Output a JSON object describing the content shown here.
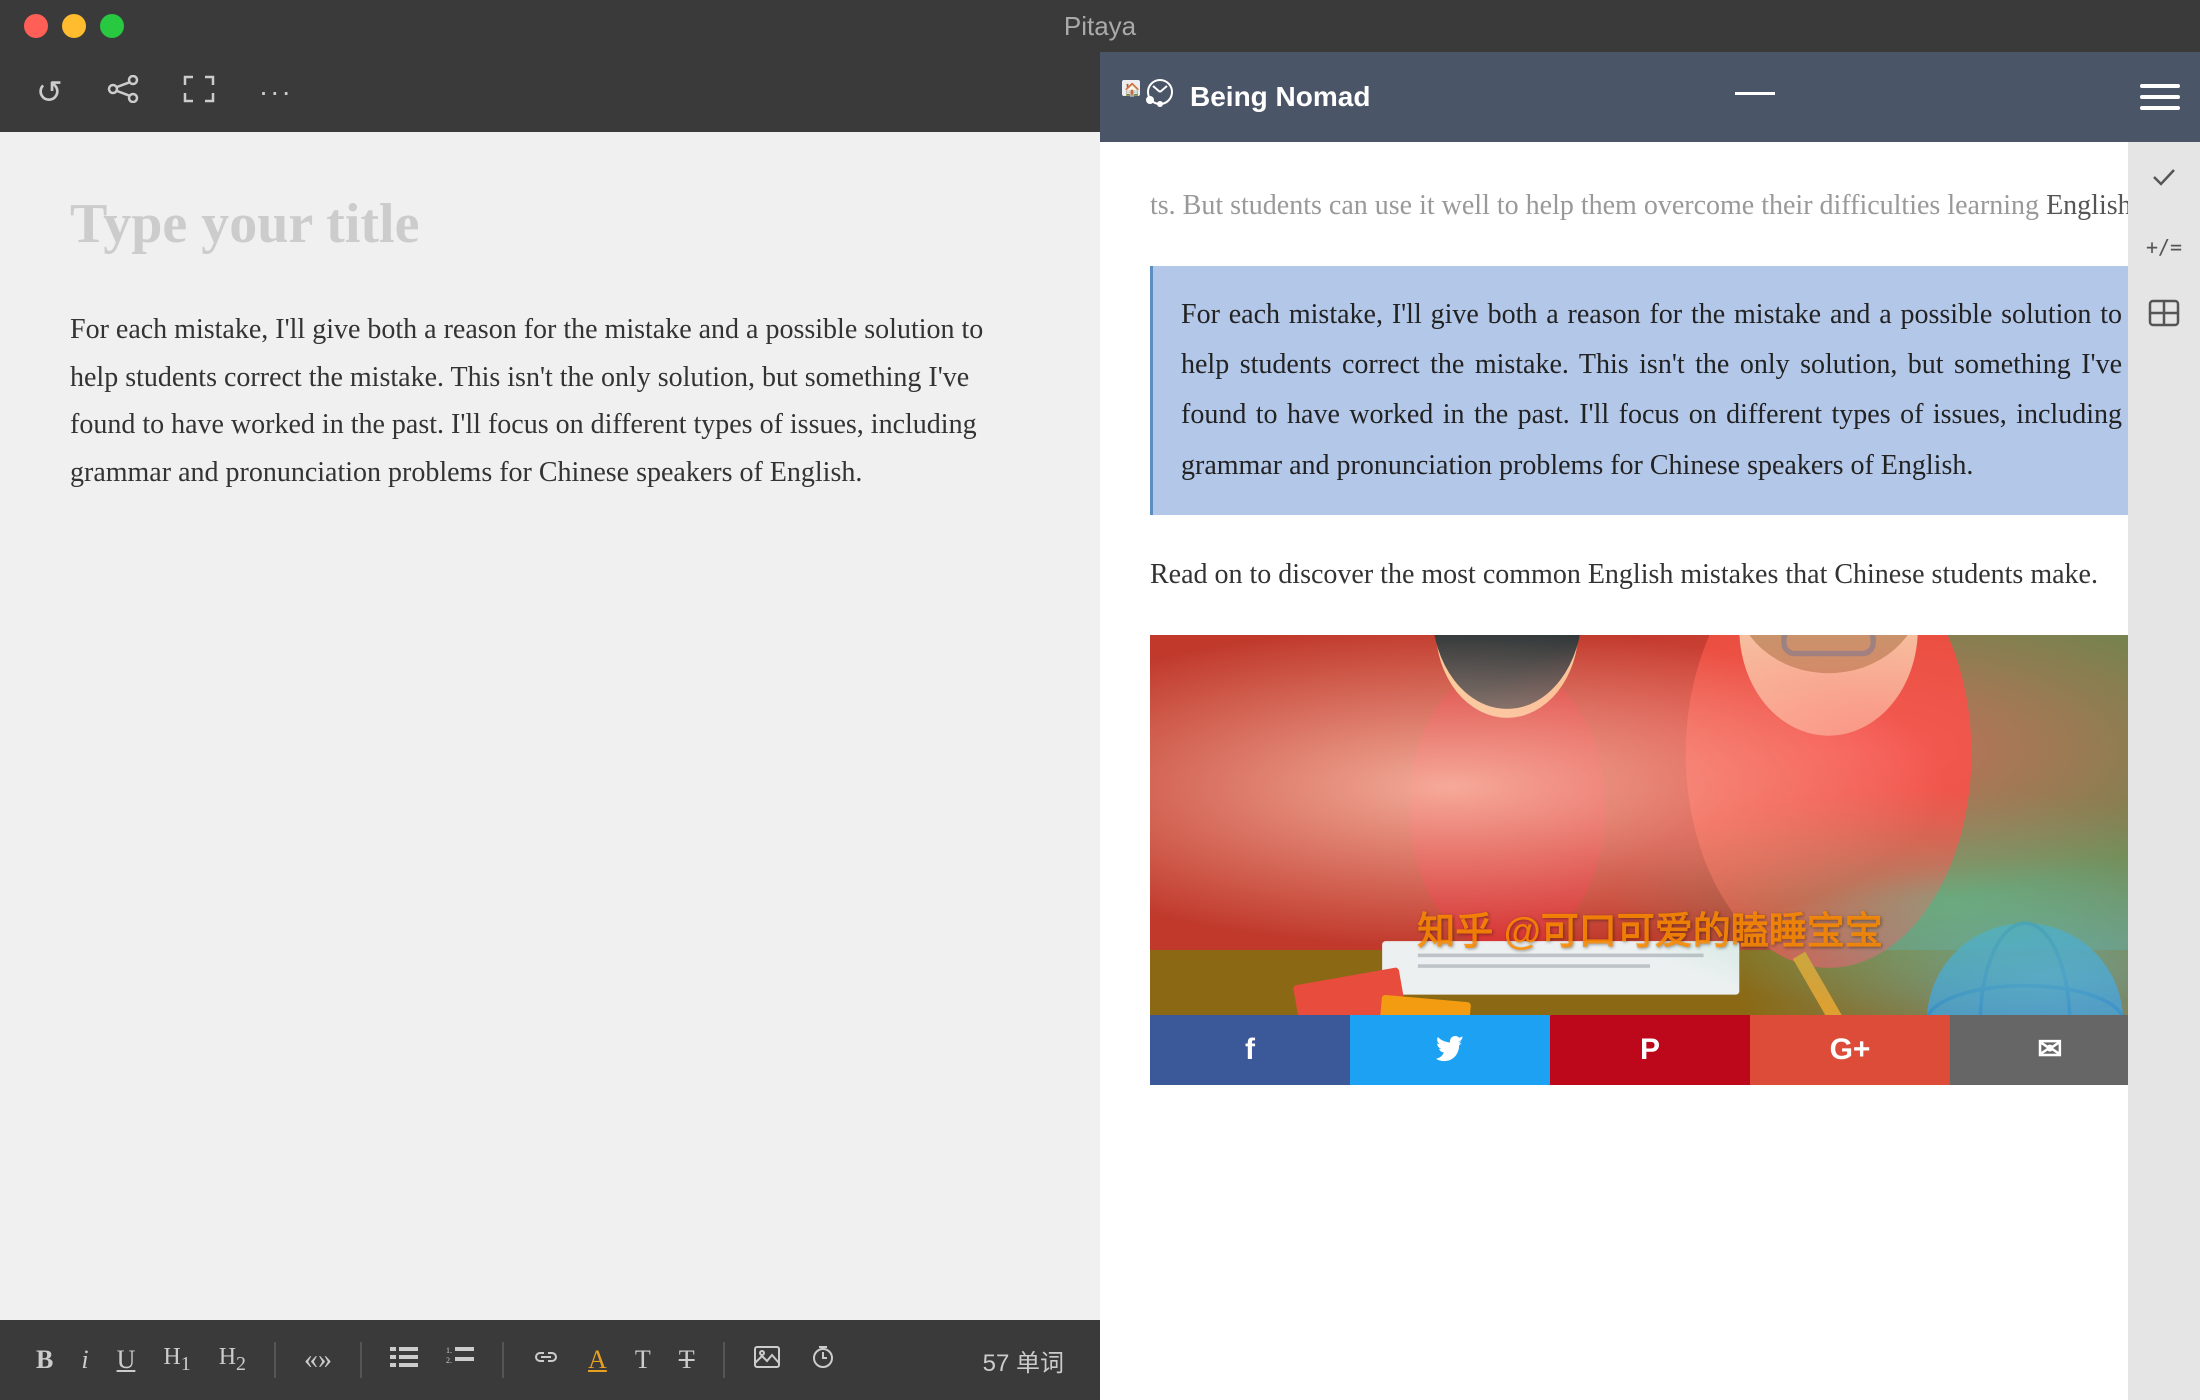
{
  "titlebar": {
    "title": "Pitaya"
  },
  "toolbar": {
    "refresh_label": "↺",
    "share_label": "⎋",
    "fullscreen_label": "⛶",
    "more_label": "···"
  },
  "editor": {
    "title_placeholder": "Type your title",
    "body_text": "For each mistake, I'll give both a reason for the mistake and a possible solution to help students correct the mistake. This isn't the only solution, but something I've found to have worked in the past. I'll focus on different types of issues, including grammar and pronunciation problems for Chinese speakers of English."
  },
  "format_toolbar": {
    "bold": "B",
    "italic": "i",
    "underline": "U",
    "h1": "H₁",
    "h2": "H₂",
    "quote": "«»",
    "list_bullet": "≡",
    "list_number": "≣",
    "link": "⛓",
    "highlight": "A",
    "text": "T",
    "clear": "T̶",
    "image": "⊞",
    "clock": "⊙",
    "word_count": "57 单词"
  },
  "browser": {
    "logo_text": "Being Nomad",
    "logo_icon": "🏠",
    "intro_text": "ts. But students can use it well to help them overcome their difficulties learning English.",
    "highlighted_paragraph": "For each mistake, I'll give both a reason for the mistake and a possible solution to help students correct the mistake. This isn't the only solution, but something I've found to have worked in the past. I'll focus on different types of issues, including grammar and pronunciation problems for Chinese speakers of English.",
    "read_on_text": "Read on to discover the most common English mistakes that Chinese students make.",
    "watermark": "知乎 @可口可爱的瞌睡宝宝",
    "social": {
      "facebook": "f",
      "twitter": "🐦",
      "pinterest": "P",
      "googleplus": "G+",
      "email": "✉"
    }
  },
  "sidebar": {
    "check_icon": "✓",
    "formula_icon": "+/=",
    "translate_icon": "⊓"
  },
  "detected": {
    "to_word": "to",
    "english_word": "English"
  }
}
